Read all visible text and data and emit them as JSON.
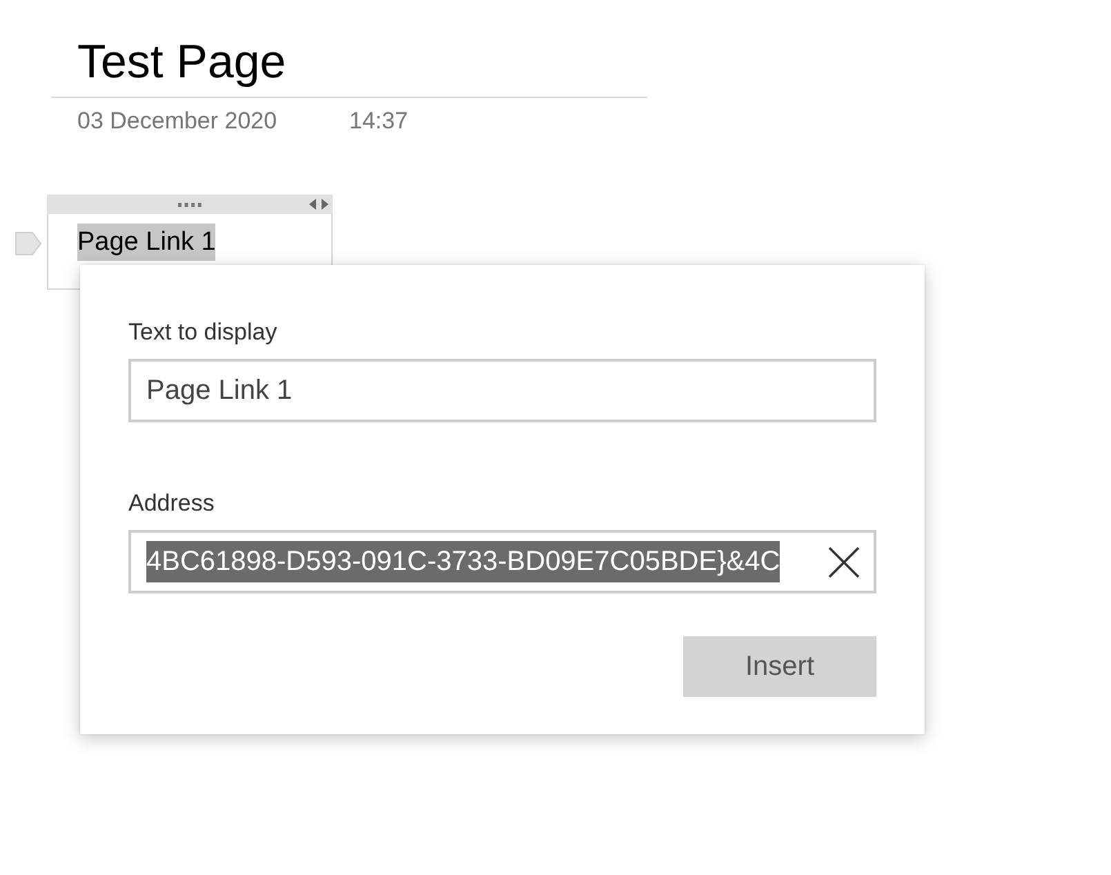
{
  "page": {
    "title": "Test Page",
    "date": "03 December 2020",
    "time": "14:37"
  },
  "note": {
    "text": "Page Link 1",
    "text_selected": true
  },
  "dialog": {
    "fields": [
      {
        "label": "Text to display",
        "value": "Page Link 1",
        "text_selected": false,
        "clear_button": false
      },
      {
        "label": "Address",
        "value": "4BC61898-D593-091C-3733-BD09E7C05BDE}&4C",
        "text_selected": true,
        "clear_button": true
      }
    ],
    "button": {
      "label": "Insert"
    }
  }
}
